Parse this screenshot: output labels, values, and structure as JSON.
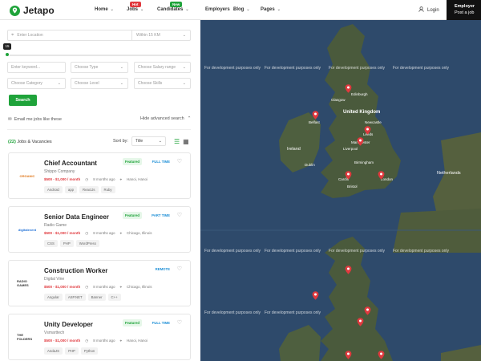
{
  "header": {
    "logo_text": "Jetapo",
    "nav": [
      {
        "label": "Home",
        "badge": null
      },
      {
        "label": "Jobs",
        "badge": "Hot",
        "badge_color": "#e0393e"
      },
      {
        "label": "Candidates",
        "badge": "New",
        "badge_color": "#1fa33a"
      },
      {
        "label": "Employers",
        "badge": null
      },
      {
        "label": "Blog",
        "badge": null
      },
      {
        "label": "Pages",
        "badge": null
      }
    ],
    "login_label": "Login",
    "employer_line1": "Employer",
    "employer_line2": "Post a job"
  },
  "filters": {
    "location_placeholder": "Enter Location",
    "radius_label": "Within 15 KM",
    "radius_value": "15",
    "keyword_placeholder": "Enter keyword...",
    "type_placeholder": "Choose Type",
    "salary_placeholder": "Choose Salary range",
    "category_placeholder": "Choose Category",
    "level_placeholder": "Choose Level",
    "skills_placeholder": "Choose Skills",
    "search_label": "Search",
    "email_label": "Email me jobs like these",
    "advanced_label": "Hide advanced search"
  },
  "results": {
    "count": "(22)",
    "count_label": "Jobs & Vacancies",
    "sort_label": "Sort by:",
    "sort_value": "Title"
  },
  "jobs": [
    {
      "title": "Chief Accountant",
      "company": "Shippo Company",
      "salary": "$500 - $1,000 / month",
      "posted": "8 months ago",
      "location": "Hanoi, Hanoi",
      "featured": "Featured",
      "type": "FULL TIME",
      "type_color": "#1e8fd6",
      "tags": [
        "Android",
        "app",
        "ReactJs",
        "Ruby"
      ],
      "logo_text": "ORGANIC"
    },
    {
      "title": "Senior Data Engineer",
      "company": "Radio Game",
      "salary": "$500 - $1,000 / month",
      "posted": "8 months ago",
      "location": "Chicago, Illinois",
      "featured": "Featured",
      "type": "PART TIME",
      "type_color": "#1e8fd6",
      "tags": [
        "CSS",
        "PHP",
        "WordPress"
      ],
      "logo_text": "digitalevent"
    },
    {
      "title": "Construction Worker",
      "company": "Digital Vine",
      "salary": "$500 - $1,000 / month",
      "posted": "8 months ago",
      "location": "Chicago, Illinois",
      "featured": "",
      "type": "REMOTE",
      "type_color": "#1e8fd6",
      "tags": [
        "Angular",
        "ASP.NET",
        "Banner",
        "C++"
      ],
      "logo_text": "RADIO GAMES"
    },
    {
      "title": "Unity Developer",
      "company": "Vsmarttech",
      "salary": "$500 - $1,000 / month",
      "posted": "8 months ago",
      "location": "Hanoi, Hanoi",
      "featured": "Featured",
      "type": "FULL TIME",
      "type_color": "#1e8fd6",
      "tags": [
        "AndaJS",
        "PHP",
        "Python"
      ],
      "logo_text": "THE FOLDERS"
    }
  ],
  "map": {
    "watermark": "For development purposes only",
    "labels": [
      "United Kingdom",
      "Ireland",
      "Netherlands",
      "Glasgow",
      "Edinburgh",
      "Belfast",
      "Dublin",
      "Liverpool",
      "Manchester",
      "Birmingham",
      "London",
      "Cardiff",
      "Bristol",
      "Leeds",
      "Newcastle"
    ],
    "water_color": "#2e4a6b",
    "land_color": "#4a5a3c"
  }
}
